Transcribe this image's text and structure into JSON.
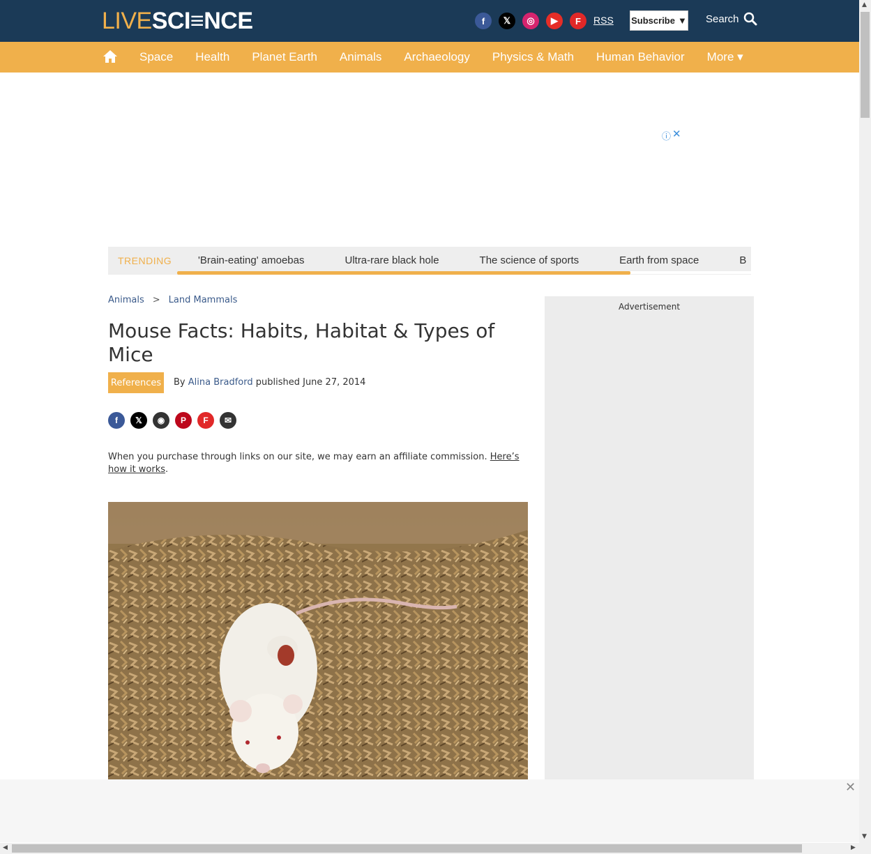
{
  "header": {
    "logo_live": "LIVE",
    "logo_science": "SCI≡NCE",
    "socials": [
      {
        "icon": "facebook-icon",
        "glyph": "f",
        "color": "#3b5998"
      },
      {
        "icon": "x-icon",
        "glyph": "𝕏",
        "color": "#000000"
      },
      {
        "icon": "instagram-icon",
        "glyph": "◎",
        "color": "#d6246e"
      },
      {
        "icon": "youtube-icon",
        "glyph": "▶",
        "color": "#e52d27"
      },
      {
        "icon": "flipboard-icon",
        "glyph": "F",
        "color": "#e12828"
      }
    ],
    "rss_label": "RSS",
    "subscribe_label": "Subscribe",
    "search_label": "Search"
  },
  "nav": {
    "items": [
      "Space",
      "Health",
      "Planet Earth",
      "Animals",
      "Archaeology",
      "Physics & Math",
      "Human Behavior",
      "More ▾"
    ]
  },
  "ad_top": {
    "info_glyph": "ⓘ",
    "close_glyph": "✕"
  },
  "trending": {
    "label": "TRENDING",
    "items": [
      "'Brain-eating' amoebas",
      "Ultra-rare black hole",
      "The science of sports",
      "Earth from space",
      "B"
    ],
    "progress": 0.79
  },
  "breadcrumb": {
    "items": [
      "Animals",
      "Land Mammals"
    ],
    "separator": ">"
  },
  "article": {
    "title": "Mouse Facts: Habits, Habitat & Types of Mice",
    "references_label": "References",
    "by": "By",
    "author": "Alina Bradford",
    "published": "published June 27, 2014",
    "share": [
      {
        "icon": "facebook-icon",
        "glyph": "f",
        "color": "#3b5998"
      },
      {
        "icon": "x-icon",
        "glyph": "𝕏",
        "color": "#000000"
      },
      {
        "icon": "reddit-icon",
        "glyph": "◉",
        "color": "#333333"
      },
      {
        "icon": "pinterest-icon",
        "glyph": "P",
        "color": "#bd081c"
      },
      {
        "icon": "flipboard-icon",
        "glyph": "F",
        "color": "#e12828"
      },
      {
        "icon": "email-icon",
        "glyph": "✉",
        "color": "#333333"
      }
    ],
    "affiliate_text": "When you purchase through links on our site, we may earn an affiliate commission. ",
    "affiliate_link": "Here’s how it works",
    "affiliate_end": "."
  },
  "sidebar": {
    "ad_label": "Advertisement"
  },
  "bottom_ad": {
    "close_glyph": "✕"
  },
  "colors": {
    "brand_navy": "#1b3a57",
    "brand_orange": "#f0b04b"
  }
}
